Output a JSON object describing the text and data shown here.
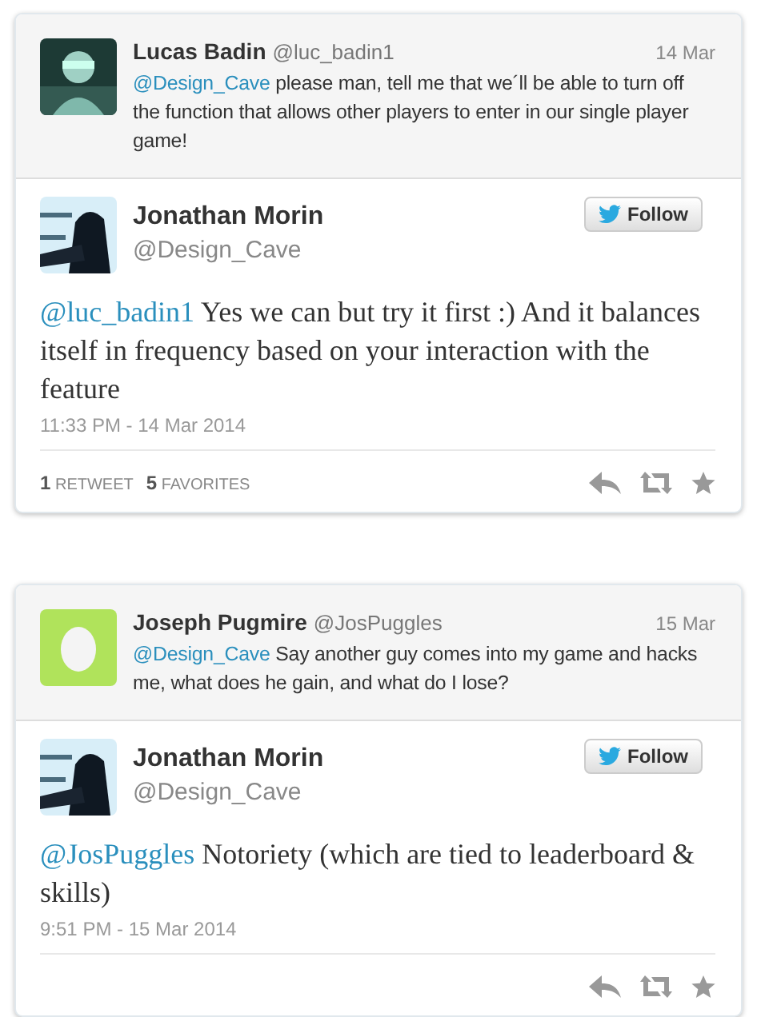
{
  "threads": [
    {
      "in_reply_to": {
        "name": "Lucas Badin",
        "handle": "@luc_badin1",
        "date": "14 Mar",
        "mention": "@Design_Cave",
        "text": "please man, tell me that we´ll be able to turn off the function that allows other players to enter in our single player game!"
      },
      "tweet": {
        "name": "Jonathan Morin",
        "handle": "@Design_Cave",
        "follow": "Follow",
        "mention": "@luc_badin1",
        "text": "Yes we can but try it first :) And it balances itself in frequency based on your interaction with the feature",
        "timestamp": "11:33 PM - 14 Mar 2014",
        "stats": [
          "**1** RETWEET",
          "**5** FAVORITES"
        ]
      }
    },
    {
      "in_reply_to": {
        "name": "Joseph Pugmire",
        "handle": "@JosPuggles",
        "date": "15 Mar",
        "mention": "@Design_Cave",
        "text": "Say another guy comes into my game and hacks me, what does he gain, and what do I lose?",
        "avatar": {
          "kind": "egg"
        }
      },
      "tweet": {
        "name": "Jonathan Morin",
        "handle": "@Design_Cave",
        "follow": "Follow",
        "mention": "@JosPuggles",
        "text": "Notoriety (which are tied to leaderboard & skills)",
        "timestamp": "9:51 PM - 15 Mar 2014"
      }
    }
  ]
}
